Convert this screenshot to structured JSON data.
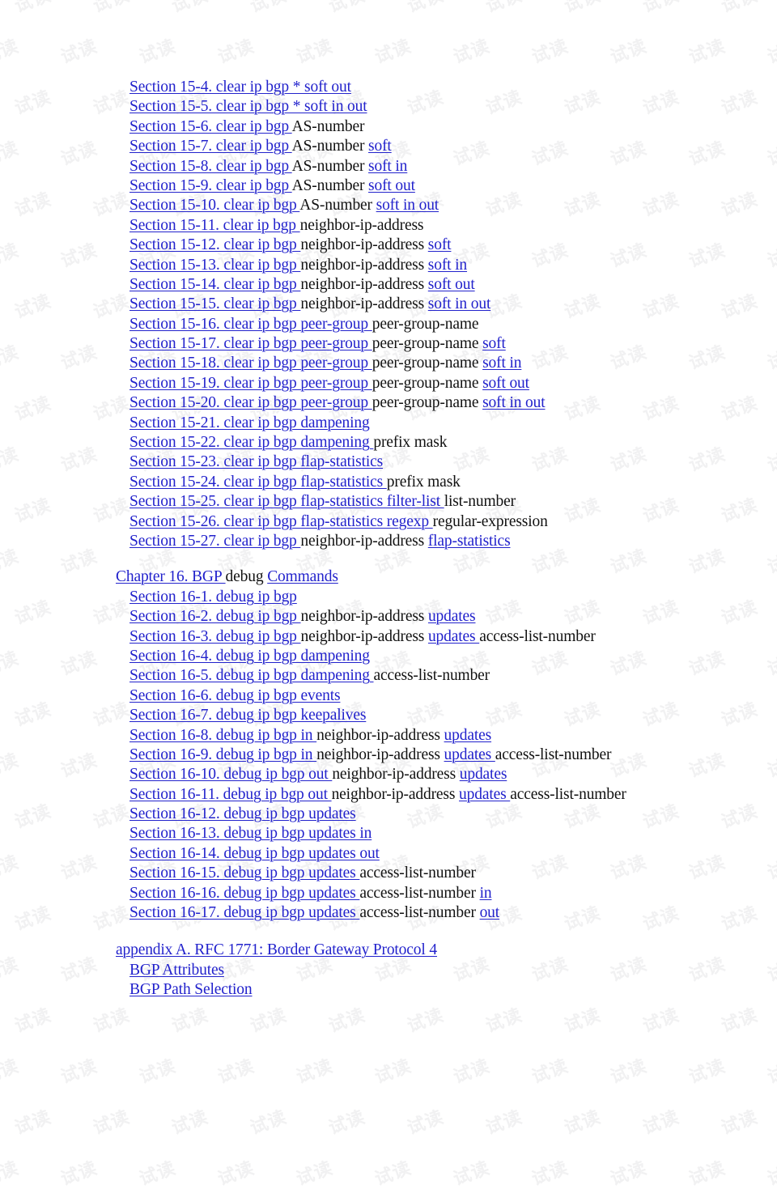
{
  "page": {
    "kind": "table-of-contents",
    "watermark_text": "试读",
    "link_color": "#2222cc",
    "text_color": "#111111",
    "background_color": "#ffffff",
    "watermark_color": "#f1f1f2"
  },
  "entries": [
    {
      "level": "section",
      "segments": [
        {
          "text": "Section 15-4.  clear ip bgp * soft out",
          "link": true
        }
      ]
    },
    {
      "level": "section",
      "segments": [
        {
          "text": "Section 15-5.  clear ip bgp * soft in out",
          "link": true
        }
      ]
    },
    {
      "level": "section",
      "segments": [
        {
          "text": "Section 15-6.  clear ip bgp ",
          "link": true
        },
        {
          "text": "AS-number",
          "link": false
        }
      ]
    },
    {
      "level": "section",
      "segments": [
        {
          "text": "Section 15-7.  clear ip bgp ",
          "link": true
        },
        {
          "text": "AS-number ",
          "link": false
        },
        {
          "text": "soft",
          "link": true
        }
      ]
    },
    {
      "level": "section",
      "segments": [
        {
          "text": "Section 15-8.  clear ip bgp ",
          "link": true
        },
        {
          "text": "AS-number ",
          "link": false
        },
        {
          "text": "soft in",
          "link": true
        }
      ]
    },
    {
      "level": "section",
      "segments": [
        {
          "text": "Section 15-9.  clear ip bgp ",
          "link": true
        },
        {
          "text": "AS-number ",
          "link": false
        },
        {
          "text": "soft out",
          "link": true
        }
      ]
    },
    {
      "level": "section",
      "segments": [
        {
          "text": "Section 15-10.  clear ip bgp ",
          "link": true
        },
        {
          "text": "AS-number ",
          "link": false
        },
        {
          "text": "soft in out",
          "link": true
        }
      ]
    },
    {
      "level": "section",
      "segments": [
        {
          "text": "Section 15-11.  clear ip bgp ",
          "link": true
        },
        {
          "text": "neighbor-ip-address",
          "link": false
        }
      ]
    },
    {
      "level": "section",
      "segments": [
        {
          "text": "Section 15-12.  clear ip bgp ",
          "link": true
        },
        {
          "text": "neighbor-ip-address ",
          "link": false
        },
        {
          "text": "soft",
          "link": true
        }
      ]
    },
    {
      "level": "section",
      "segments": [
        {
          "text": "Section 15-13.  clear ip bgp ",
          "link": true
        },
        {
          "text": "neighbor-ip-address ",
          "link": false
        },
        {
          "text": "soft in",
          "link": true
        }
      ]
    },
    {
      "level": "section",
      "segments": [
        {
          "text": "Section 15-14.  clear ip bgp ",
          "link": true
        },
        {
          "text": "neighbor-ip-address ",
          "link": false
        },
        {
          "text": "soft out",
          "link": true
        }
      ]
    },
    {
      "level": "section",
      "segments": [
        {
          "text": "Section 15-15.  clear ip bgp ",
          "link": true
        },
        {
          "text": "neighbor-ip-address ",
          "link": false
        },
        {
          "text": "soft in out",
          "link": true
        }
      ]
    },
    {
      "level": "section",
      "segments": [
        {
          "text": "Section 15-16.  clear ip bgp peer-group ",
          "link": true
        },
        {
          "text": "peer-group-name",
          "link": false
        }
      ]
    },
    {
      "level": "section",
      "segments": [
        {
          "text": "Section 15-17.  clear ip bgp peer-group ",
          "link": true
        },
        {
          "text": "peer-group-name ",
          "link": false
        },
        {
          "text": "soft",
          "link": true
        }
      ]
    },
    {
      "level": "section",
      "segments": [
        {
          "text": "Section 15-18.  clear ip bgp peer-group ",
          "link": true
        },
        {
          "text": "peer-group-name ",
          "link": false
        },
        {
          "text": "soft in",
          "link": true
        }
      ]
    },
    {
      "level": "section",
      "segments": [
        {
          "text": "Section 15-19.  clear ip bgp peer-group ",
          "link": true
        },
        {
          "text": "peer-group-name ",
          "link": false
        },
        {
          "text": "soft out",
          "link": true
        }
      ]
    },
    {
      "level": "section",
      "segments": [
        {
          "text": "Section 15-20.  clear ip bgp peer-group ",
          "link": true
        },
        {
          "text": "peer-group-name ",
          "link": false
        },
        {
          "text": "soft in out",
          "link": true
        }
      ]
    },
    {
      "level": "section",
      "segments": [
        {
          "text": "Section 15-21.  clear ip bgp dampening",
          "link": true
        }
      ]
    },
    {
      "level": "section",
      "segments": [
        {
          "text": "Section 15-22.  clear ip bgp dampening ",
          "link": true
        },
        {
          "text": "prefix mask",
          "link": false
        }
      ]
    },
    {
      "level": "section",
      "segments": [
        {
          "text": "Section 15-23.  clear ip bgp flap-statistics",
          "link": true
        }
      ]
    },
    {
      "level": "section",
      "segments": [
        {
          "text": "Section 15-24.  clear ip bgp flap-statistics ",
          "link": true
        },
        {
          "text": "prefix mask",
          "link": false
        }
      ]
    },
    {
      "level": "section",
      "segments": [
        {
          "text": "Section 15-25.  clear ip bgp flap-statistics filter-list ",
          "link": true
        },
        {
          "text": "list-number",
          "link": false
        }
      ]
    },
    {
      "level": "section",
      "segments": [
        {
          "text": "Section 15-26.  clear ip bgp flap-statistics regexp ",
          "link": true
        },
        {
          "text": "regular-expression",
          "link": false
        }
      ]
    },
    {
      "level": "section",
      "segments": [
        {
          "text": "Section 15-27.  clear ip bgp ",
          "link": true
        },
        {
          "text": "neighbor-ip-address ",
          "link": false
        },
        {
          "text": "flap-statistics",
          "link": true
        }
      ]
    },
    {
      "level": "spacer"
    },
    {
      "level": "chapter",
      "segments": [
        {
          "text": "Chapter 16.  BGP ",
          "link": true
        },
        {
          "text": "debug ",
          "link": false
        },
        {
          "text": "Commands",
          "link": true
        }
      ]
    },
    {
      "level": "section",
      "segments": [
        {
          "text": "Section 16-1.  debug ip bgp",
          "link": true
        }
      ]
    },
    {
      "level": "section",
      "segments": [
        {
          "text": "Section 16-2.  debug ip bgp ",
          "link": true
        },
        {
          "text": "neighbor-ip-address ",
          "link": false
        },
        {
          "text": "updates",
          "link": true
        }
      ]
    },
    {
      "level": "section",
      "segments": [
        {
          "text": "Section 16-3.  debug ip bgp ",
          "link": true
        },
        {
          "text": "neighbor-ip-address ",
          "link": false
        },
        {
          "text": "updates ",
          "link": true
        },
        {
          "text": "access-list-number",
          "link": false
        }
      ]
    },
    {
      "level": "section",
      "segments": [
        {
          "text": "Section 16-4.  debug ip bgp dampening",
          "link": true
        }
      ]
    },
    {
      "level": "section",
      "segments": [
        {
          "text": "Section 16-5.  debug ip bgp dampening ",
          "link": true
        },
        {
          "text": "access-list-number",
          "link": false
        }
      ]
    },
    {
      "level": "section",
      "segments": [
        {
          "text": "Section 16-6.  debug ip bgp events",
          "link": true
        }
      ]
    },
    {
      "level": "section",
      "segments": [
        {
          "text": "Section 16-7.  debug ip bgp keepalives",
          "link": true
        }
      ]
    },
    {
      "level": "section",
      "segments": [
        {
          "text": "Section 16-8.  debug ip bgp in ",
          "link": true
        },
        {
          "text": "neighbor-ip-address ",
          "link": false
        },
        {
          "text": "updates",
          "link": true
        }
      ]
    },
    {
      "level": "section",
      "segments": [
        {
          "text": "Section 16-9.  debug ip bgp in ",
          "link": true
        },
        {
          "text": "neighbor-ip-address ",
          "link": false
        },
        {
          "text": "updates ",
          "link": true
        },
        {
          "text": "access-list-number",
          "link": false
        }
      ]
    },
    {
      "level": "section",
      "segments": [
        {
          "text": "Section 16-10.  debug ip bgp out ",
          "link": true
        },
        {
          "text": "neighbor-ip-address ",
          "link": false
        },
        {
          "text": "updates",
          "link": true
        }
      ]
    },
    {
      "level": "section",
      "segments": [
        {
          "text": "Section 16-11.  debug ip bgp out ",
          "link": true
        },
        {
          "text": "neighbor-ip-address ",
          "link": false
        },
        {
          "text": "updates ",
          "link": true
        },
        {
          "text": "access-list-number",
          "link": false
        }
      ]
    },
    {
      "level": "section",
      "segments": [
        {
          "text": "Section 16-12.  debug ip bgp updates",
          "link": true
        }
      ]
    },
    {
      "level": "section",
      "segments": [
        {
          "text": "Section 16-13.  debug ip bgp updates in",
          "link": true
        }
      ]
    },
    {
      "level": "section",
      "segments": [
        {
          "text": "Section 16-14.  debug ip bgp updates out",
          "link": true
        }
      ]
    },
    {
      "level": "section",
      "segments": [
        {
          "text": "Section 16-15.  debug ip bgp updates ",
          "link": true
        },
        {
          "text": "access-list-number",
          "link": false
        }
      ]
    },
    {
      "level": "section",
      "segments": [
        {
          "text": "Section 16-16.  debug ip bgp updates ",
          "link": true
        },
        {
          "text": "access-list-number ",
          "link": false
        },
        {
          "text": "in",
          "link": true
        }
      ]
    },
    {
      "level": "section",
      "segments": [
        {
          "text": "Section 16-17.  debug ip bgp updates ",
          "link": true
        },
        {
          "text": "access-list-number ",
          "link": false
        },
        {
          "text": "out",
          "link": true
        }
      ]
    },
    {
      "level": "spacer-block"
    },
    {
      "level": "chapter",
      "segments": [
        {
          "text": "appendix A.  RFC 1771: Border Gateway Protocol 4",
          "link": true
        }
      ]
    },
    {
      "level": "section",
      "segments": [
        {
          "text": "BGP Attributes",
          "link": true
        }
      ]
    },
    {
      "level": "section",
      "segments": [
        {
          "text": "BGP Path Selection",
          "link": true
        }
      ]
    }
  ]
}
